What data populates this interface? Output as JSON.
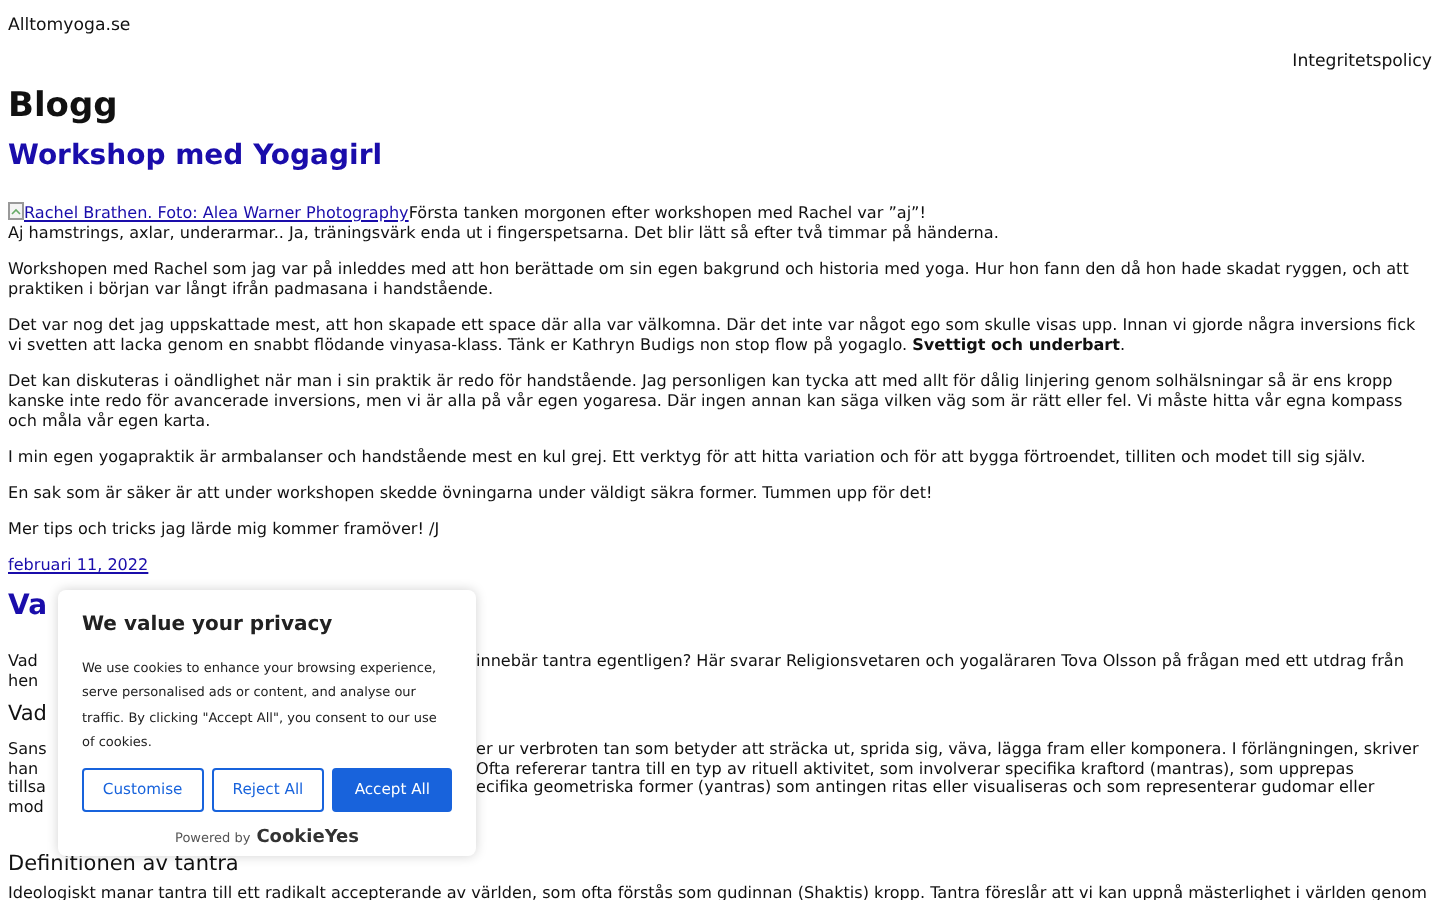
{
  "site_title": "Alltomyoga.se",
  "nav_link": "Integritetspolicy",
  "page_title": "Blogg",
  "post": {
    "title": "Workshop med Yogagirl",
    "image_link": "Rachel Brathen. Foto: Alea Warner Photography",
    "intro_lines": [
      "Första tanken morgonen efter workshopen med Rachel var ”aj”!",
      "Aj hamstrings, axlar, underarmar.. Ja, träningsvärk enda ut i fingerspetsarna. Det blir lätt så efter två timmar på händerna."
    ],
    "paragraphs": [
      "Workshopen med Rachel som jag var på inleddes med att hon berättade om sin egen bakgrund och historia med yoga. Hur hon fann den då hon hade skadat ryggen, och att praktiken i början var långt ifrån padmasana i handstående.",
      "Det var nog det jag uppskattade mest, att hon skapade ett space där alla var välkomna. Där det inte var något ego som skulle visas upp. Innan vi gjorde några inversions fick vi svetten att lacka genom en snabbt flödande vinyasa-klass. Tänk er Kathryn Budigs non stop flow på yogaglo. **Svettigt och underbart**.",
      "Det kan diskuteras i oändlighet när man i sin praktik är redo för handstående. Jag personligen kan tycka att med allt för dålig linjering genom solhälsningar så är ens kropp kanske inte redo för avancerade inversions, men vi är alla på vår egen yogaresa. Där ingen annan kan säga vilken väg som är rätt eller fel. Vi måste hitta vår egna kompass och måla vår egen karta.",
      "I min egen yogapraktik är armbalanser och handstående mest en kul grej. Ett verktyg för att hitta variation och för att bygga förtroendet, tilliten och modet till sig själv.",
      "En sak som är säker är att under workshopen skedde övningarna under väldigt säkra former. Tummen upp för det!",
      "Mer tips och tricks jag lärde mig kommer framöver! /J"
    ],
    "date": "februari 11, 2022"
  },
  "covered_post": {
    "rows": [
      {
        "kind": "title",
        "left": "Va"
      },
      {
        "kind": "text",
        "left": "Vad",
        "right": "innebär tantra egentligen? Här svarar Religionsvetaren och yogaläraren Tova Olsson på frågan med ett utdrag från"
      },
      {
        "kind": "text",
        "left": "hen"
      },
      {
        "kind": "subheading",
        "left": "Vad"
      },
      {
        "kind": "text",
        "left": "Sans",
        "right": "er ur verbroten tan som betyder att sträcka ut, sprida sig, väva, lägga fram eller komponera. I förlängningen, skriver"
      },
      {
        "kind": "text",
        "left": "han",
        "right": "Ofta refererar tantra till en typ av rituell aktivitet, som involverar specifika kraftord (mantras), som upprepas"
      },
      {
        "kind": "text",
        "left": "tillsa",
        "right": "ecifika geometriska former (yantras) som antingen ritas eller visualiseras och som representerar gudomar eller"
      },
      {
        "kind": "text",
        "left": "mod"
      }
    ],
    "subheading": "Definitionen av tantra",
    "text": "Ideologiskt manar tantra till ett radikalt accepterande av världen, som ofta förstås som gudinnan (Shaktis) kropp. Tantra föreslår att vi kan uppnå mästerlighet i världen genom"
  },
  "cookie_banner": {
    "title": "We value your privacy",
    "text": "We use cookies to enhance your browsing experience, serve personalised ads or content, and analyse our traffic. By clicking \"Accept All\", you consent to our use of cookies.",
    "buttons": [
      {
        "label": "Customise",
        "kind": "outline"
      },
      {
        "label": "Reject All",
        "kind": "outline"
      },
      {
        "label": "Accept All",
        "kind": "primary"
      }
    ],
    "powered_by": "Powered by",
    "brand": "CookieYes"
  }
}
